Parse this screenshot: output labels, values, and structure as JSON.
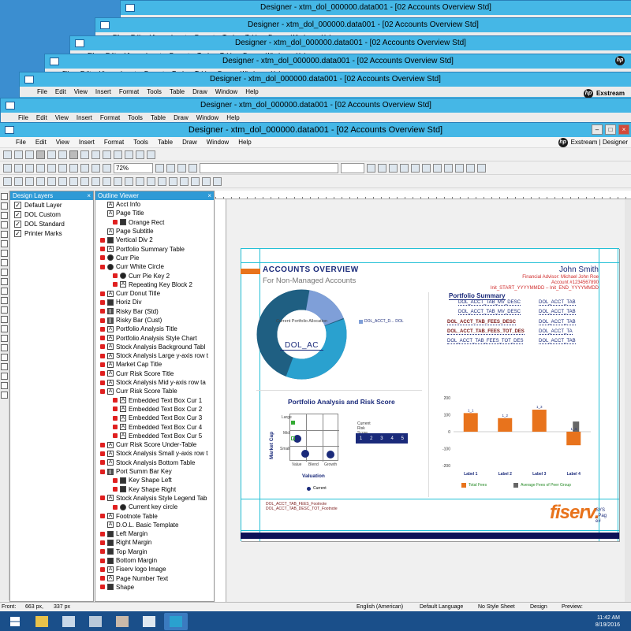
{
  "window_title": "Designer - xtm_dol_000000.data001 - [02 Accounts Overview Std]",
  "menu": [
    "File",
    "Edit",
    "View",
    "Insert",
    "Format",
    "Tools",
    "Table",
    "Draw",
    "Window",
    "Help"
  ],
  "brand": "Exstream | Designer",
  "brand_short": "Exstream",
  "toolbar": {
    "zoom": "72%"
  },
  "layers_panel": {
    "title": "Design Layers",
    "items": [
      {
        "label": "Default Layer",
        "checked": true
      },
      {
        "label": "DOL Custom",
        "checked": true
      },
      {
        "label": "DOL Standard",
        "checked": true
      },
      {
        "label": "Printer Marks",
        "checked": true
      }
    ]
  },
  "outline_panel": {
    "title": "Outline Viewer",
    "items": [
      "Acct Info",
      "Page Title",
      "Orange Rect",
      "Page Subtitle",
      "Vertical Div 2",
      "Portfolio Summary Table",
      "Curr Pie",
      "Curr White Circle",
      "Curr Pie Key 2",
      "Repeating Key Block 2",
      "Curr Donut Title",
      "Horiz Div",
      "Risky Bar (Std)",
      "Risky Bar (Cust)",
      "Portfolio Analysis Title",
      "Portfolio Analysis Style Chart",
      "Stock Analysis Background Tabl",
      "Stock Analysis Large y-axis row t",
      "Market Cap Title",
      "Curr Risk Score Title",
      "Stock Analysis Mid y-axis row ta",
      "Curr Risk Score Table",
      "Embedded Text Box Cur 1",
      "Embedded Text Box Cur 2",
      "Embedded Text Box Cur 3",
      "Embedded Text Box Cur 4",
      "Embedded Text Box Cur 5",
      "Curr Risk Score Under-Table",
      "Stock Analysis Small y-axis row t",
      "Stock Analysis Bottom Table",
      "Port Summ Bar Key",
      "Key Shape Left",
      "Key Shape Right",
      "Stock Analysis Style Legend Tab",
      "Current key circle",
      "Footnote Table",
      "D.O.L. Basic Template",
      "Left Margin",
      "Right Margin",
      "Top Margin",
      "Bottom Margin",
      "Fiserv logo Image",
      "Page Number Text",
      "Shape"
    ]
  },
  "document": {
    "title": "ACCOUNTS OVERVIEW",
    "subtitle": "For Non-Managed Accounts",
    "advisor_name": "John Smith",
    "advisor_line": "Financial Advisor: Michael John Roe",
    "account_line": "Account #1234567890",
    "init_line": "Init_START_YYYYMMDD – Init_END_YYYYMMDD",
    "donut_caption": "Current Portfolio Allocation",
    "donut_code": "DOL_AC",
    "donut_legend": "DOL_ACCT_D...",
    "donut_legend2": "DOL",
    "portfolio_summary_title": "Portfolio Summary",
    "ps_rows": [
      "DOL_ACCT_TAB_MV_DESC",
      "DOL_ACCT_TAB",
      "DOL_ACCT_TAB_MV_DESC",
      "DOL_ACCT_TAB",
      "DOL_ACCT_TAB_FEES_DESC",
      "DOL_ACCT_TAB",
      "DOL_ACCT_TAB_FEES_TOT_DES",
      "DOL_ACCT_TA",
      "DOL_ACCT_TAB_FEES_TOT_DES",
      "DOL_ACCT_TAB"
    ],
    "pa_title": "Portfolio Analysis and Risk Score",
    "market_cap": "Market Cap",
    "valuation": "Valuation",
    "cap_labels": [
      "Large",
      "Mid",
      "Small"
    ],
    "val_labels": [
      "Value",
      "Blend",
      "Growth"
    ],
    "current": "Current",
    "risk_label": "Current Risk Score",
    "risk_scores": [
      "1",
      "2",
      "3",
      "4",
      "5"
    ],
    "footnote1": "DOL_ACCT_TAB_FEES_Footnote",
    "footnote2": "DOL_ACCT_TAB_DESC_TOT_Footnote",
    "logo": "fiserv.",
    "sys": "SYS_Page#",
    "legend_total": "Total Fees",
    "legend_avg": "Average Fees of Peer Group"
  },
  "chart_data": {
    "type": "bar",
    "categories": [
      "Label 1",
      "Label 2",
      "Label 3",
      "Label 4"
    ],
    "series": [
      {
        "name": "Total Fees",
        "values": [
          110,
          80,
          130,
          -80
        ]
      },
      {
        "name": "Average Fees of Peer Group",
        "values": [
          0,
          0,
          0,
          60
        ]
      }
    ],
    "ylim": [
      -200,
      200
    ],
    "yticks": [
      "200",
      "100",
      "0",
      "-100",
      "-200"
    ],
    "data_labels": [
      "1_1",
      "1_2",
      "1_3",
      "1_4"
    ],
    "colors": [
      "#e8731c",
      "#666666"
    ]
  },
  "status": {
    "front": "Front:",
    "x": "663 px,",
    "y": "337 px",
    "lang": "English (American)",
    "deflang": "Default Language",
    "style": "No Style Sheet",
    "mode": "Design",
    "preview": "Preview:"
  },
  "clock": {
    "time": "11:42 AM",
    "date": "8/19/2016"
  }
}
